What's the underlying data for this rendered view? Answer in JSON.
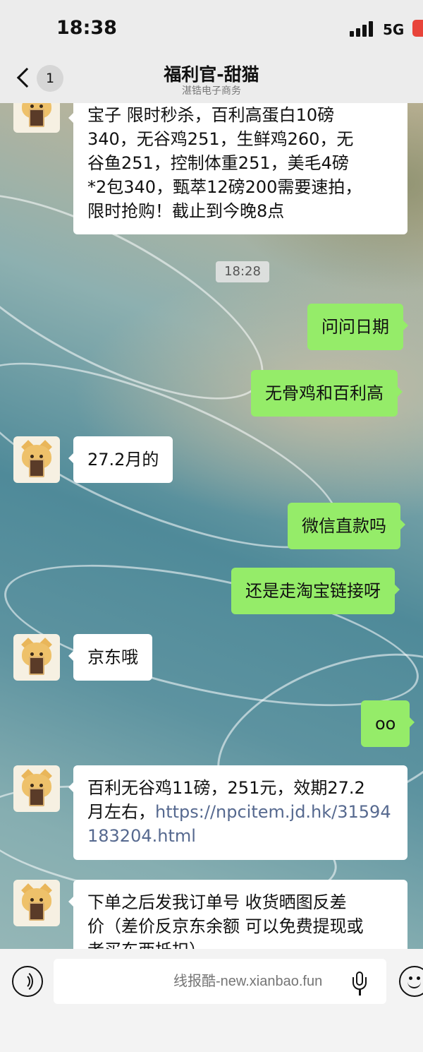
{
  "status_bar": {
    "time": "18:38",
    "network": "5G"
  },
  "header": {
    "back_badge": "1",
    "title": "福利官-甜猫",
    "subtitle": "湛锆电子商务"
  },
  "messages": [
    {
      "side": "in",
      "text": "宝子 限时秒杀，百利高蛋白10磅340，无谷鸡251，生鲜鸡260，无谷鱼251，控制体重251，美毛4磅*2包340，甄萃12磅200需要速拍，限时抢购！截止到今晚8点",
      "lines": [
        "宝子 限时秒杀，百利高蛋白10磅",
        "340，无谷鸡251，生鲜鸡260，无",
        "谷鱼251，控制体重251，美毛4磅",
        "*2包340，甄萃12磅200需要速拍，",
        "限时抢购！截止到今晚8点"
      ]
    },
    {
      "side": "time",
      "text": "18:28"
    },
    {
      "side": "out",
      "text": "问问日期"
    },
    {
      "side": "out",
      "text": "无骨鸡和百利高"
    },
    {
      "side": "in",
      "text": "27.2月的"
    },
    {
      "side": "out",
      "text": "微信直款吗"
    },
    {
      "side": "out",
      "text": "还是走淘宝链接呀"
    },
    {
      "side": "in",
      "text": "京东哦"
    },
    {
      "side": "out",
      "text": "oo"
    },
    {
      "side": "in",
      "lines": [
        "百利无谷鸡11磅，251元，效期27.2",
        "月左右，"
      ],
      "link_parts": [
        "https://npcitem.jd.hk/31594",
        "183204.html"
      ]
    },
    {
      "side": "in",
      "lines": [
        "下单之后发我订单号 收货晒图反差",
        "价（差价反京东余额 可以免费提现或",
        "者买东西抵扣）"
      ]
    }
  ],
  "input": {
    "placeholder": "线报酷-new.xianbao.fun"
  },
  "icons": {
    "back": "chevron-left-icon",
    "voice": "voice-icon",
    "mic": "microphone-icon",
    "emoji": "emoji-icon"
  },
  "colors": {
    "outgoing_bubble": "#95ec69",
    "incoming_bubble": "#ffffff",
    "link": "#56698f"
  }
}
